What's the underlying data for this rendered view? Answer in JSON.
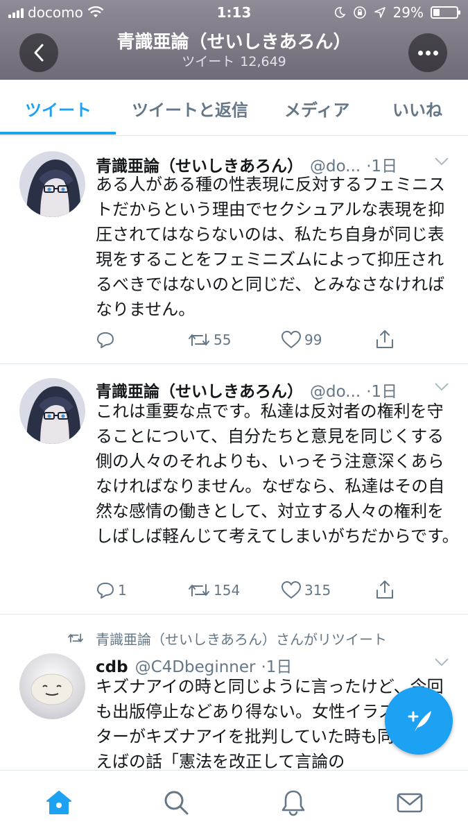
{
  "status_bar": {
    "carrier": "docomo",
    "time": "1:13",
    "battery_percent": "29%",
    "battery_level": 0.29
  },
  "header": {
    "title": "青識亜論（せいしきあろん）",
    "tweets_label": "ツイート",
    "tweets_count": "12,649"
  },
  "tabs": [
    {
      "label": "ツイート",
      "active": true
    },
    {
      "label": "ツイートと返信",
      "active": false
    },
    {
      "label": "メディア",
      "active": false
    },
    {
      "label": "いいね",
      "active": false
    }
  ],
  "tweets": [
    {
      "name": "青識亜論（せいしきあろん）",
      "handle": "@do...",
      "time": "·1日",
      "text": "ある人がある種の性表現に反対するフェミニストだからという理由でセクシュアルな表現を抑圧されてはならないのは、私たち自身が同じ表現をすることをフェミニズムによって抑圧されるべきではないのと同じだ、とみなさなければなりません。",
      "replies": "",
      "retweets": "55",
      "likes": "99"
    },
    {
      "name": "青識亜論（せいしきあろん）",
      "handle": "@do...",
      "time": "·1日",
      "text": "これは重要な点です。私達は反対者の権利を守ることについて、自分たちと意見を同じくする側の人々のそれよりも、いっそう注意深くあらなければなりません。なぜなら、私達はその自然な感情の働きとして、対立する人々の権利をしばしば軽んじて考えてしまいがちだからです。",
      "replies": "1",
      "retweets": "154",
      "likes": "315"
    },
    {
      "retweeted_by": "青識亜論（せいしきあろん）さんがリツイート",
      "name": "cdb",
      "handle": "@C4Dbeginner",
      "time": "·1日",
      "text": "キズナアイの時と同じように言ったけど、今回も出版停止などあり得ない。女性イラストレーターがキズナアイを批判していた時も同じ。例えばの話「憲法を改正して言論の"
    }
  ],
  "icons": {
    "back": "chevron-left-icon",
    "more": "more-dots-icon",
    "reply": "reply-icon",
    "retweet": "retweet-icon",
    "like": "heart-icon",
    "share": "share-icon",
    "compose": "compose-tweet-icon",
    "home": "home-icon",
    "search": "search-icon",
    "notifications": "bell-icon",
    "messages": "envelope-icon"
  },
  "colors": {
    "accent": "#1da1f2",
    "muted": "#657786",
    "text": "#14171a",
    "header_bg": "#7d7a85"
  }
}
